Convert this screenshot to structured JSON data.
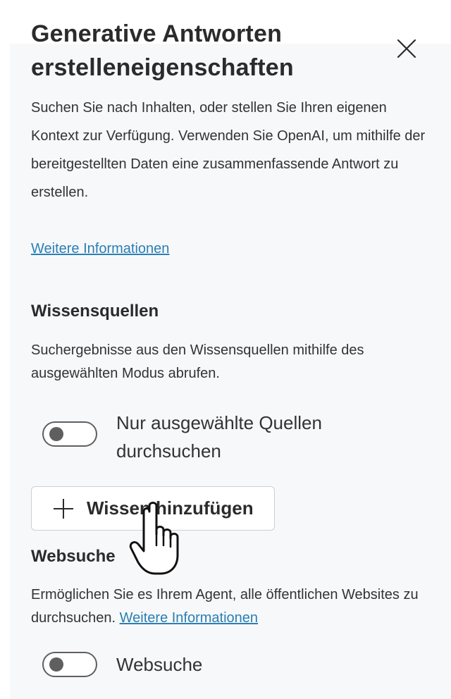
{
  "panel": {
    "title": "Generative Antworten erstelleneigenschaften",
    "description": "Suchen Sie nach Inhalten, oder stellen Sie Ihren eigenen Kontext zur Verfügung. Verwenden Sie OpenAI, um mithilfe der bereitgestellten Daten eine zusammenfassende Antwort zu erstellen.",
    "more_info_link": "Weitere Informationen",
    "close_icon": "close-icon"
  },
  "knowledge": {
    "heading": "Wissensquellen",
    "description": "Suchergebnisse aus den Wissensquellen mithilfe des ausgewählten Modus abrufen.",
    "toggle_label": "Nur ausgewählte Quellen durchsuchen",
    "toggle_on": false,
    "add_button_label": "Wissen hinzufügen",
    "add_button_icon": "plus-icon"
  },
  "web_search": {
    "heading": "Websuche",
    "description": "Ermöglichen Sie es Ihrem Agent, alle öffentlichen Websites zu durchsuchen.",
    "more_info_link": "Weitere Informationen",
    "toggle_label": "Websuche",
    "toggle_on": false
  },
  "cursor": {
    "icon": "hand-pointer-icon"
  },
  "colors": {
    "link": "#2a7fb3",
    "panel_background": "#f7f8fa",
    "toggle_off": "#5f5f5f"
  }
}
